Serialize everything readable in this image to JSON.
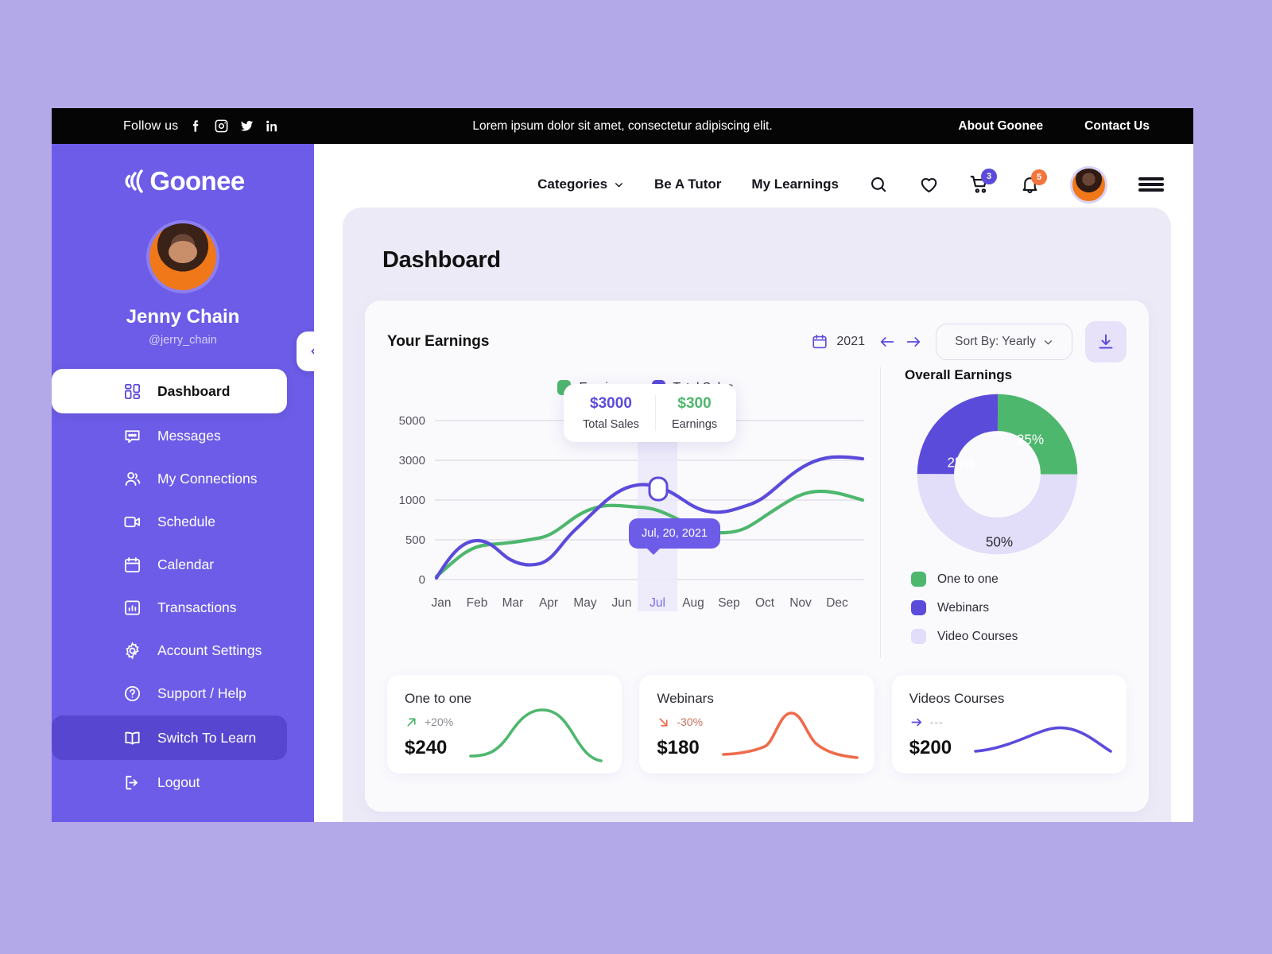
{
  "topbar": {
    "follow_label": "Follow us",
    "social": [
      "facebook-icon",
      "instagram-icon",
      "twitter-icon",
      "linkedin-icon"
    ],
    "promo": "Lorem ipsum dolor sit amet, consectetur adipiscing elit.",
    "about": "About Goonee",
    "contact": "Contact Us"
  },
  "brand": {
    "name": "Goonee"
  },
  "profile": {
    "name": "Jenny Chain",
    "handle": "@jerry_chain"
  },
  "sidebar": {
    "items": [
      {
        "label": "Dashboard",
        "icon": "grid-icon",
        "state": "active"
      },
      {
        "label": "Messages",
        "icon": "chat-icon",
        "state": "normal"
      },
      {
        "label": "My Connections",
        "icon": "people-icon",
        "state": "normal"
      },
      {
        "label": "Schedule",
        "icon": "video-icon",
        "state": "normal"
      },
      {
        "label": "Calendar",
        "icon": "calendar-icon",
        "state": "normal"
      },
      {
        "label": "Transactions",
        "icon": "bar-chart-icon",
        "state": "normal"
      },
      {
        "label": "Account Settings",
        "icon": "gear-icon",
        "state": "normal"
      },
      {
        "label": "Support / Help",
        "icon": "question-icon",
        "state": "normal"
      },
      {
        "label": "Switch To Learn",
        "icon": "book-icon",
        "state": "highlight"
      },
      {
        "label": "Logout",
        "icon": "logout-icon",
        "state": "normal"
      }
    ],
    "collapse_icon": "chevron-left-icon"
  },
  "nav": {
    "links": [
      "Categories",
      "Be A Tutor",
      "My Learnings"
    ],
    "categories_caret": "chevron-down-icon",
    "cart_badge": "3",
    "bell_badge": "5",
    "icons": [
      "search-icon",
      "heart-icon",
      "cart-icon",
      "bell-icon",
      "avatar",
      "hamburger-icon"
    ]
  },
  "page": {
    "title": "Dashboard"
  },
  "earnings_panel": {
    "title": "Your Earnings",
    "year": "2021",
    "calendar_icon": "calendar-icon",
    "prev_icon": "arrow-left-icon",
    "next_icon": "arrow-right-icon",
    "sort_label": "Sort By: Yearly",
    "download_icon": "download-icon"
  },
  "tooltip": {
    "total_sales_value": "$3000",
    "total_sales_label": "Total Sales",
    "earnings_value": "$300",
    "earnings_label": "Earnings",
    "date": "Jul, 20, 2021"
  },
  "donut_title": "Overall Earnings",
  "donut_legend": [
    {
      "label": "One to one",
      "color": "#4eb76e"
    },
    {
      "label": "Webinars",
      "color": "#5b4bdb"
    },
    {
      "label": "Video Courses",
      "color": "#e2ddf8"
    }
  ],
  "cards": [
    {
      "title": "One to one",
      "delta": "+20%",
      "value": "$240",
      "trend": "up",
      "color": "#4eb76e",
      "arrow_icon": "arrow-up-right-icon"
    },
    {
      "title": "Webinars",
      "delta": "-30%",
      "value": "$180",
      "trend": "down",
      "color": "#ef6b4a",
      "arrow_icon": "arrow-down-right-icon"
    },
    {
      "title": "Videos Courses",
      "delta": "---",
      "value": "$200",
      "trend": "flat",
      "color": "#5b4bdb",
      "arrow_icon": "arrow-right-icon"
    }
  ],
  "colors": {
    "brand_purple": "#6c5ce7",
    "line_sales": "#5b4bdb",
    "line_earnings": "#4eb76e",
    "accent_orange": "#f4743b"
  },
  "chart_data": [
    {
      "type": "line",
      "title": "Your Earnings",
      "xlabel": "",
      "ylabel": "",
      "categories": [
        "Jan",
        "Feb",
        "Mar",
        "Apr",
        "May",
        "Jun",
        "Jul",
        "Aug",
        "Sep",
        "Oct",
        "Nov",
        "Dec"
      ],
      "ytick_labels": [
        "0",
        "500",
        "1000",
        "3000",
        "5000"
      ],
      "ylim": [
        0,
        5000
      ],
      "grid": true,
      "legend": [
        "Earnings",
        "Total Sales"
      ],
      "legend_position": "top-center",
      "highlight_category": "Jul",
      "annotation": "Jul, 20, 2021",
      "series": [
        {
          "name": "Total Sales",
          "color": "#5b4bdb",
          "values": [
            100,
            510,
            370,
            290,
            800,
            1300,
            1800,
            1500,
            950,
            1100,
            2500,
            3100
          ]
        },
        {
          "name": "Earnings",
          "color": "#4eb76e",
          "values": [
            90,
            300,
            370,
            480,
            700,
            900,
            900,
            800,
            680,
            740,
            1200,
            1150
          ]
        }
      ]
    },
    {
      "type": "pie",
      "title": "Overall Earnings",
      "labels": [
        "One to one",
        "Webinars",
        "Video Courses"
      ],
      "values": [
        25,
        25,
        50
      ],
      "value_labels": [
        "25%",
        "25%",
        "50%"
      ],
      "colors": [
        "#4eb76e",
        "#5b4bdb",
        "#e2ddf8"
      ],
      "donut": true,
      "legend_position": "bottom-left"
    }
  ]
}
